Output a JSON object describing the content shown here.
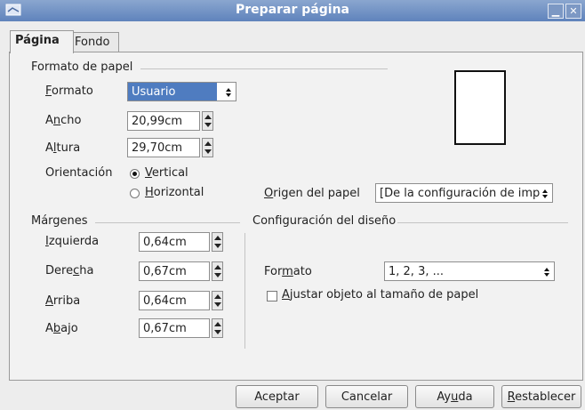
{
  "window": {
    "title": "Preparar página"
  },
  "tabs": [
    {
      "label": "Página"
    },
    {
      "label": "Fondo"
    }
  ],
  "paper_format": {
    "section_title": "Formato de papel",
    "format": {
      "label": "Formato",
      "value": "Usuario"
    },
    "width": {
      "label": "Ancho",
      "value": "20,99cm"
    },
    "height": {
      "label": "Altura",
      "value": "29,70cm"
    },
    "orientation": {
      "label": "Orientación",
      "vertical": "Vertical",
      "horizontal": "Horizontal",
      "selected": "Vertical"
    },
    "paper_source": {
      "label": "Origen del papel",
      "value": "[De la configuración de imp"
    }
  },
  "margins": {
    "section_title": "Márgenes",
    "left": {
      "label": "Izquierda",
      "value": "0,64cm"
    },
    "right": {
      "label": "Derecha",
      "value": "0,67cm"
    },
    "top": {
      "label": "Arriba",
      "value": "0,64cm"
    },
    "bottom": {
      "label": "Abajo",
      "value": "0,67cm"
    }
  },
  "layout": {
    "section_title": "Configuración del diseño",
    "format": {
      "label": "Formato",
      "value": "1, 2, 3, ..."
    },
    "fit_object": {
      "label": "Ajustar objeto al tamaño de papel",
      "checked": false
    }
  },
  "buttons": {
    "ok": "Aceptar",
    "cancel": "Cancelar",
    "help": "Ayuda",
    "reset": "Restablecer"
  },
  "colors": {
    "selection_highlight": "#4f7cc0",
    "titlebar": "#6a8cc2"
  }
}
